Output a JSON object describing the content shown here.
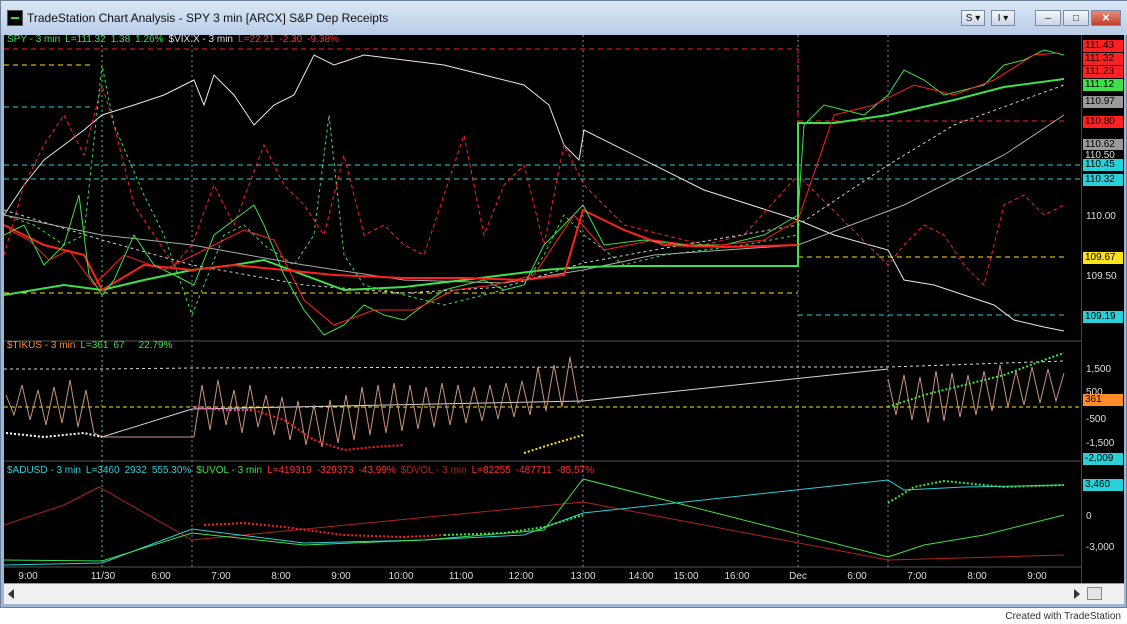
{
  "window": {
    "title": "TradeStation Chart Analysis - SPY 3 min [ARCX] S&P Dep Receipts",
    "buttons": {
      "s_label": "S",
      "i_label": "I",
      "minimize": "–",
      "maximize": "□",
      "close": "✕"
    }
  },
  "pane1": {
    "header": [
      {
        "text": "SPY - 3 min",
        "color": "#3fe04a"
      },
      {
        "text": "L=111.32",
        "color": "#3fe04a"
      },
      {
        "text": "1.38",
        "color": "#3fe04a"
      },
      {
        "text": "1.26%",
        "color": "#3fe04a"
      },
      {
        "text": "$VIX.X - 3 min",
        "color": "#e0e0e0"
      },
      {
        "text": "L=22.21",
        "color": "#ff3030"
      },
      {
        "text": "-2.30",
        "color": "#ff3030"
      },
      {
        "text": "-9.38%",
        "color": "#ff3030"
      }
    ],
    "price_ticks": [
      "110.00",
      "109.50"
    ],
    "price_boxes": [
      {
        "label": "111.43",
        "bg": "#ff2020",
        "fg": "#000"
      },
      {
        "label": "111.32",
        "bg": "#ff2020",
        "fg": "#000"
      },
      {
        "label": "111.23",
        "bg": "#ff2020",
        "fg": "#000"
      },
      {
        "label": "111.12",
        "bg": "#3fe04a",
        "fg": "#000"
      },
      {
        "label": "110.97",
        "bg": "#9a9a9a",
        "fg": "#000"
      },
      {
        "label": "110.80",
        "bg": "#ff2020",
        "fg": "#000"
      },
      {
        "label": "110.62",
        "bg": "#9a9a9a",
        "fg": "#000"
      },
      {
        "label": "110.50",
        "bg": "#000000",
        "fg": "#ddd"
      },
      {
        "label": "110.45",
        "bg": "#2ad0d8",
        "fg": "#000"
      },
      {
        "label": "110.32",
        "bg": "#2ad0d8",
        "fg": "#000"
      },
      {
        "label": "109.67",
        "bg": "#ffe21a",
        "fg": "#000"
      },
      {
        "label": "109.19",
        "bg": "#2ad0d8",
        "fg": "#000"
      }
    ]
  },
  "pane2": {
    "header": [
      {
        "text": "$TIKUS - 3 min",
        "color": "#ff8c2a"
      },
      {
        "text": "L=361",
        "color": "#3fe04a"
      },
      {
        "text": "67",
        "color": "#3fe04a"
      },
      {
        "text": "22.79%",
        "color": "#3fe04a"
      }
    ],
    "ticks": [
      "1,500",
      "500",
      "-500",
      "-1,500"
    ],
    "box_361": "361",
    "box_neg2009": "-2,009"
  },
  "pane3": {
    "header": [
      {
        "text": "$ADUSD - 3 min",
        "color": "#2ad0d8"
      },
      {
        "text": "L=3460",
        "color": "#2ad0d8"
      },
      {
        "text": "2932",
        "color": "#2ad0d8"
      },
      {
        "text": "555.30%",
        "color": "#2ad0d8"
      },
      {
        "text": "$UVOL - 3 min",
        "color": "#3fe04a"
      },
      {
        "text": "L=419319",
        "color": "#ff3030"
      },
      {
        "text": "-329373",
        "color": "#ff3030"
      },
      {
        "text": "-43.99%",
        "color": "#ff3030"
      },
      {
        "text": "$DVOL - 3 min",
        "color": "#b22222"
      },
      {
        "text": "L=82255",
        "color": "#ff3030"
      },
      {
        "text": "-487711",
        "color": "#ff3030"
      },
      {
        "text": "-85.57%",
        "color": "#ff3030"
      }
    ],
    "ticks": [
      "0",
      "-3,000"
    ],
    "box_3460": "3,460"
  },
  "x_axis": [
    "9:00",
    "11/30",
    "6:00",
    "7:00",
    "8:00",
    "9:00",
    "10:00",
    "11:00",
    "12:00",
    "13:00",
    "14:00",
    "15:00",
    "16:00",
    "Dec",
    "6:00",
    "7:00",
    "8:00",
    "9:00"
  ],
  "credit": "Created with TradeStation"
}
